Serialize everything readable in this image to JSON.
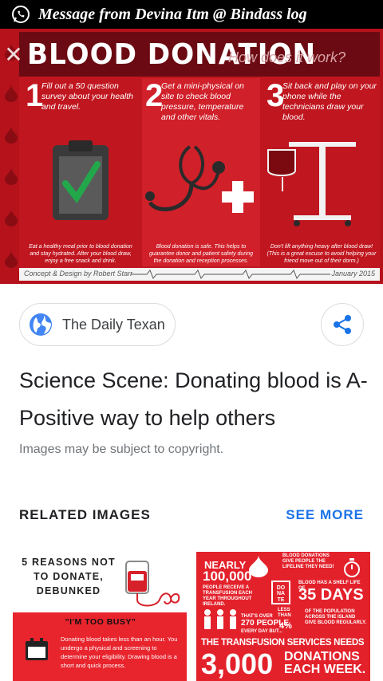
{
  "banner": {
    "message": "Message from Devina Itm @ Bindass log",
    "icon": "whatsapp-icon"
  },
  "infographic": {
    "title": "BLOOD DONATION",
    "subtitle": "How does it work?",
    "steps": [
      {
        "number": "1",
        "text": "Fill out a 50 question survey about your health and travel.",
        "footer": "Eat a healthy meal prior to blood donation and stay hydrated. After your blood draw, enjoy a free snack and drink."
      },
      {
        "number": "2",
        "text": "Get a mini-physical on site to check blood pressure, temperature and other vitals.",
        "footer": "Blood donation is safe. This helps to guarantee donor and patient safety during the donation and reception processes."
      },
      {
        "number": "3",
        "text": "Sit back and play on your phone while the technicians draw your blood.",
        "footer": "Don't lift anything heavy after blood draw! (This is a great excuse to avoid helping your friend move out of their dorm.)"
      }
    ],
    "credit": "Concept & Design by Robert Starr",
    "date": "January 2015",
    "colors": {
      "primary_red": "#c0161f",
      "dark_red": "#6b0a12",
      "accent_green": "#22a84a"
    }
  },
  "source": {
    "name": "The Daily Texan",
    "icon": "globe-icon"
  },
  "share": {
    "icon": "share-icon"
  },
  "headline": "Science Scene: Donating blood is A-Positive way to help others",
  "copyright_notice": "Images may be subject to copyright.",
  "related": {
    "title": "RELATED IMAGES",
    "see_more": "SEE MORE",
    "accent_color": "#1a73e8",
    "thumbs": [
      {
        "title": "5 REASONS NOT TO DONATE, DEBUNKED",
        "subtitle": "\"I'M TOO BUSY\"",
        "body": "Donating blood takes less than an hour. You undergo a physical and screening to determine your eligibility. Drawing blood is a short and quick process."
      },
      {
        "nearly": "NEARLY",
        "big1": "100,000",
        "line1": "PEOPLE RECEIVE A TRANSFUSION EACH YEAR THROUGHOUT IRELAND.",
        "donate": "DO NA TE",
        "shelf": "BLOOD DONATIONS GIVE PEOPLE THE LIFELINE THEY NEED!",
        "shelf2": "BLOOD HAS A SHELF LIFE OF",
        "days": "35 DAYS",
        "thats_over": "THAT'S OVER",
        "people270": "270 PEOPLE",
        "every_day": "EVERY DAY BUT...",
        "less_than": "LESS THAN",
        "pct": "4%",
        "of_pop": "OF THE POPULATION ACROSS THE ISLAND GIVE BLOOD REGULARLY.",
        "services": "THE TRANSFUSION SERVICES NEEDS",
        "big3000": "3,000",
        "donations": "DONATIONS",
        "each_week": "EACH WEEK."
      }
    ]
  }
}
